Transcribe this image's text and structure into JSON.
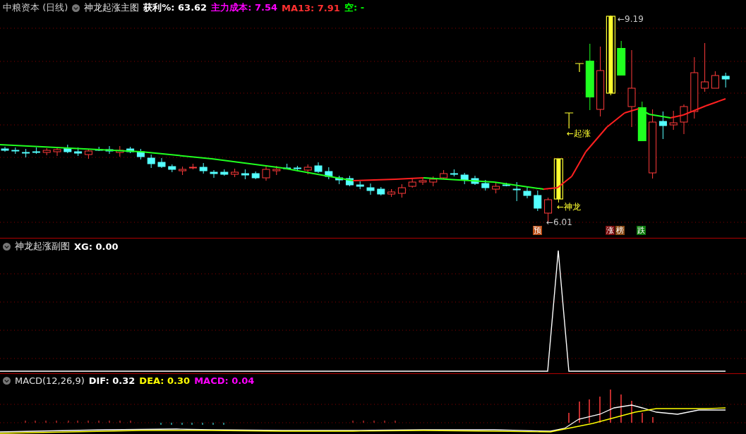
{
  "main_panel": {
    "title": "中粮资本 (日线)",
    "indicator": "神龙起涨主图",
    "readouts": [
      {
        "label": "获利%:",
        "value": "63.62",
        "color": "#ffffff"
      },
      {
        "label": "主力成本:",
        "value": "7.54",
        "color": "#ff00ff"
      },
      {
        "label": "MA13:",
        "value": "7.91",
        "color": "#ff3030"
      },
      {
        "label": "空:",
        "value": "-",
        "color": "#00ff00"
      }
    ],
    "annotations": [
      {
        "kind": "price",
        "text": "←9.19"
      },
      {
        "kind": "signal",
        "text": "←起涨"
      },
      {
        "kind": "signal",
        "text": "←神龙"
      },
      {
        "kind": "price",
        "text": "←6.01"
      }
    ],
    "markers": [
      {
        "text": "预",
        "color": "#b84a12"
      },
      {
        "text": "涨",
        "color": "#7a0a0a"
      },
      {
        "text": "榜",
        "color": "#8a4a14"
      },
      {
        "text": "跌",
        "color": "#0a7a0a"
      }
    ]
  },
  "sub_panel": {
    "indicator": "神龙起涨副图",
    "readouts": [
      {
        "label": "XG:",
        "value": "0.00",
        "color": "#ffffff"
      }
    ]
  },
  "macd_panel": {
    "indicator": "MACD(12,26,9)",
    "readouts": [
      {
        "label": "DIF:",
        "value": "0.32",
        "color": "#ffffff"
      },
      {
        "label": "DEA:",
        "value": "0.30",
        "color": "#ffff00"
      },
      {
        "label": "MACD:",
        "value": "0.04",
        "color": "#ff00ff"
      }
    ]
  }
}
